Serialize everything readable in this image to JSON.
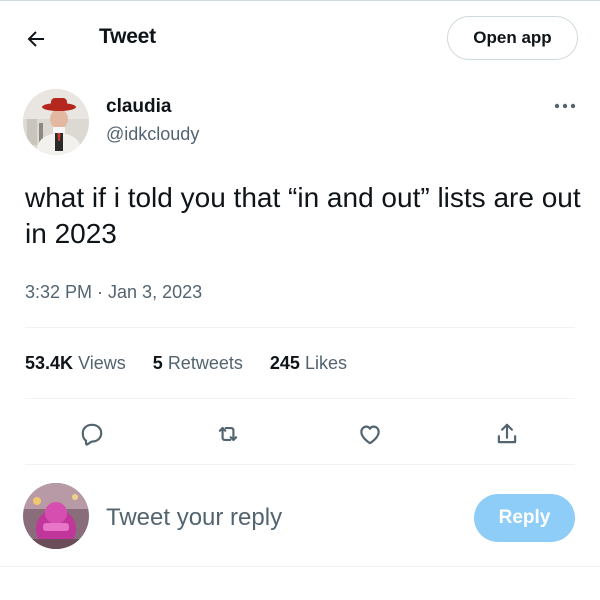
{
  "header": {
    "back_icon": "arrow-left-icon",
    "title": "Tweet",
    "open_app_label": "Open app"
  },
  "tweet": {
    "author": {
      "display_name": "claudia",
      "handle": "@idkcloudy",
      "avatar": "profile-photo"
    },
    "more_icon": "more-horizontal-icon",
    "text": "what if i told you that “in and out” lists are out in 2023",
    "timestamp": "3:32 PM · Jan 3, 2023",
    "stats": {
      "views_count": "53.4K",
      "views_label": "Views",
      "retweets_count": "5",
      "retweets_label": "Retweets",
      "likes_count": "245",
      "likes_label": "Likes"
    },
    "actions": [
      "reply-icon",
      "retweet-icon",
      "like-icon",
      "share-icon"
    ]
  },
  "reply": {
    "avatar": "own-profile-photo",
    "placeholder": "Tweet your reply",
    "button_label": "Reply"
  },
  "colors": {
    "text_primary": "#0f1419",
    "text_secondary": "#536471",
    "reply_button": "#8ecdf8",
    "border": "#cfd9de"
  }
}
